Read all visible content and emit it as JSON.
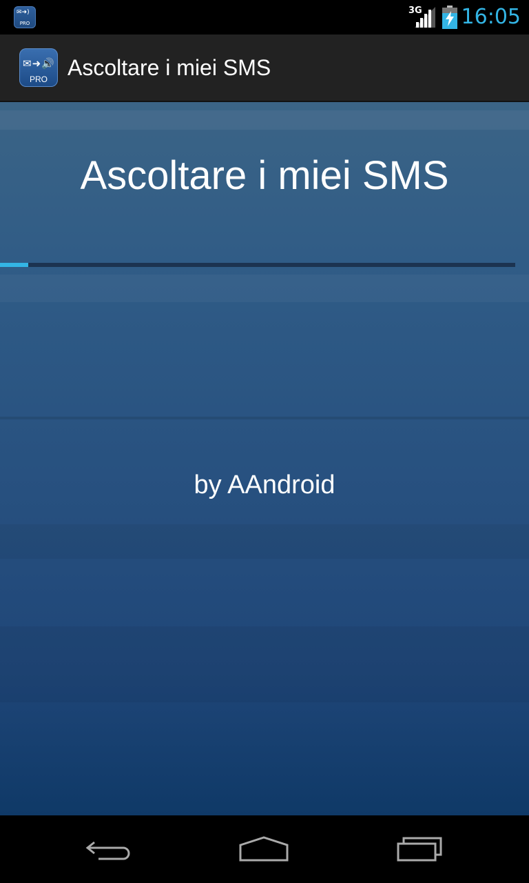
{
  "status_bar": {
    "network": "3G",
    "time": "16:05",
    "app_icon_label": "PRO",
    "accent_color": "#33b5e5"
  },
  "action_bar": {
    "title": "Ascoltare i miei SMS",
    "icon_label": "PRO"
  },
  "content": {
    "title": "Ascoltare i miei SMS",
    "progress": 0.055,
    "byline": "by AAndroid"
  },
  "nav_bar": {
    "buttons": [
      "back-icon",
      "home-icon",
      "recent-apps-icon"
    ]
  }
}
